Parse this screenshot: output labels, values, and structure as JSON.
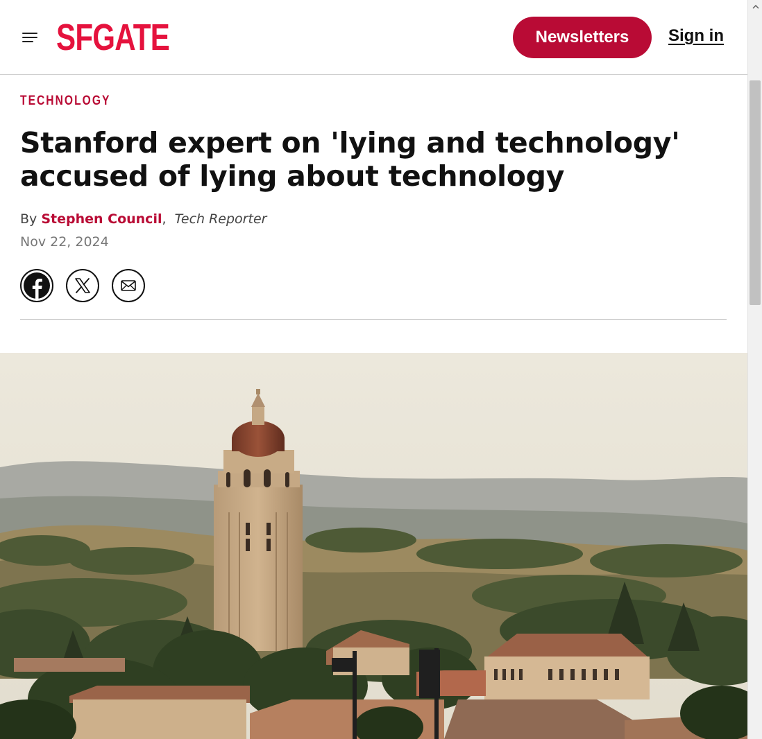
{
  "header": {
    "logo_text": "SFGATE",
    "newsletters_label": "Newsletters",
    "signin_label": "Sign in",
    "menu_icon": "hamburger-menu-icon",
    "brand_color": "#e5123d",
    "accent_color": "#b90b35"
  },
  "article": {
    "section": "TECHNOLOGY",
    "headline_line1": "Stanford expert on 'lying and technology'",
    "headline_line2": "accused of lying about technology",
    "byline_prefix": "By",
    "author": "Stephen Council",
    "author_role": "Tech Reporter",
    "date": "Nov 22, 2024"
  },
  "share": {
    "icons": [
      "facebook-icon",
      "x-twitter-icon",
      "email-icon"
    ]
  },
  "hero_image": {
    "subject": "Hoover Tower above Stanford campus with hills behind"
  }
}
